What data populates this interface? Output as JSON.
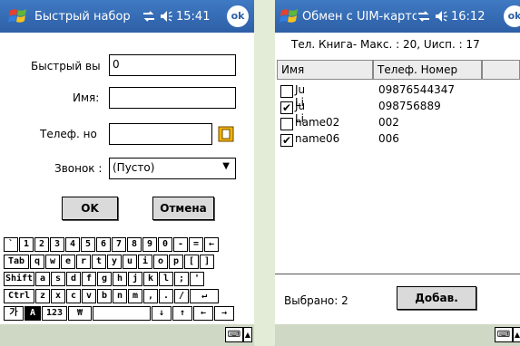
{
  "speed_dial": {
    "title": "Быстрый набор",
    "time": "15:41",
    "ok_label": "ok",
    "fields": {
      "speed_dial_label": "Быстрый вы",
      "speed_dial_value": "0",
      "name_label": "Имя:",
      "name_value": "",
      "phone_label": "Телеф. но",
      "phone_value": "",
      "ring_label": "Звонок :",
      "ring_value": "(Пусто)"
    },
    "buttons": {
      "ok": "OK",
      "cancel": "Отмена"
    },
    "keyboard": {
      "rows": [
        [
          "`",
          "1",
          "2",
          "3",
          "4",
          "5",
          "6",
          "7",
          "8",
          "9",
          "0",
          "-",
          "=",
          "←"
        ],
        [
          "Tab",
          "q",
          "w",
          "e",
          "r",
          "t",
          "y",
          "u",
          "i",
          "o",
          "p",
          "[",
          "]"
        ],
        [
          "Shift",
          "a",
          "s",
          "d",
          "f",
          "g",
          "h",
          "j",
          "k",
          "l",
          ";",
          "'"
        ],
        [
          "Ctrl",
          "z",
          "x",
          "c",
          "v",
          "b",
          "n",
          "m",
          ",",
          ".",
          "/",
          "↵"
        ],
        [
          "가",
          "A",
          "123",
          "₩",
          " ",
          "↓",
          "↑",
          "←",
          "→"
        ]
      ]
    }
  },
  "sim_exchange": {
    "title": "Обмен с UIM-карто",
    "time": "16:12",
    "ok_label": "ok",
    "info": "Тел. Книга- Макс. : 20, Uисп. : 17",
    "columns": [
      "Имя",
      "Телеф. Номер"
    ],
    "rows": [
      {
        "name": "Ju Li",
        "phone": "09876544347",
        "checked": false
      },
      {
        "name": "Ju Li",
        "phone": "098756889",
        "checked": true
      },
      {
        "name": "name02",
        "phone": "002",
        "checked": false
      },
      {
        "name": "name06",
        "phone": "006",
        "checked": true
      }
    ],
    "selected_text": "Выбрано: 2",
    "add_button": "Добав."
  },
  "icons": [
    "windows-flag-icon",
    "network-icon",
    "speaker-icon",
    "keyboard-icon",
    "checkbox-checked-icon",
    "checkbox-empty-icon",
    "contacts-book-icon"
  ]
}
